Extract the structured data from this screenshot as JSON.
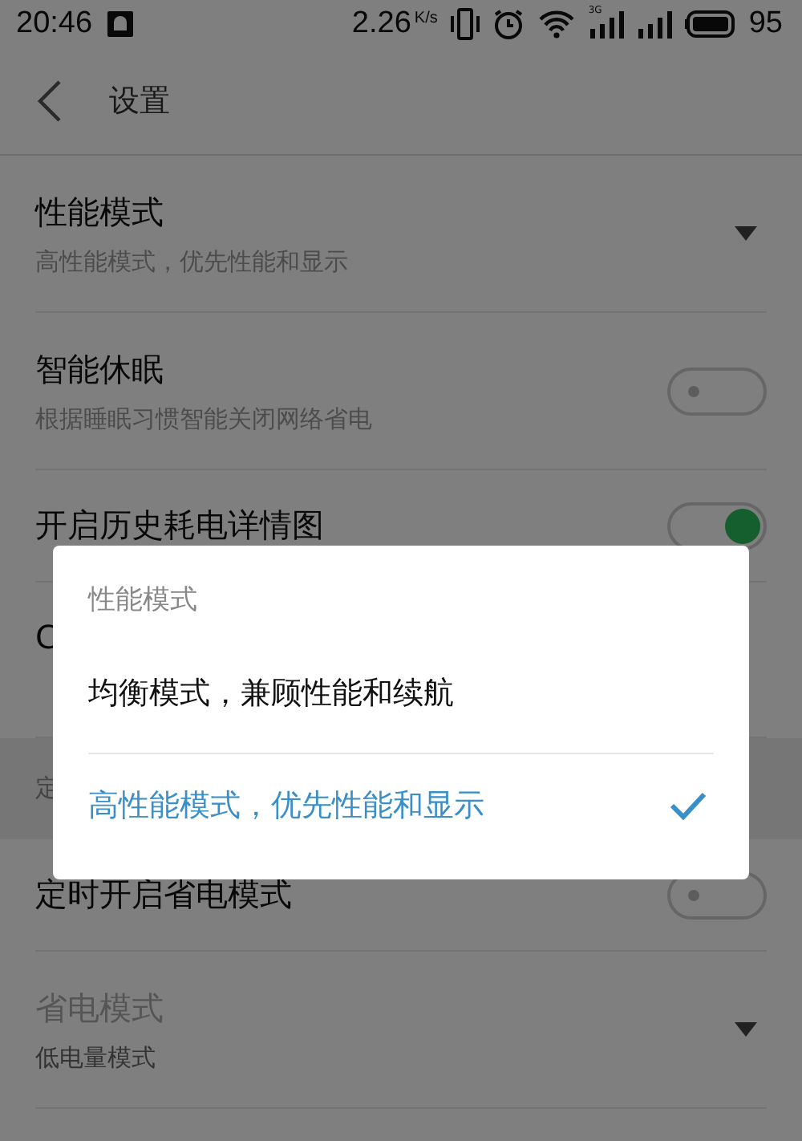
{
  "status_bar": {
    "time": "20:46",
    "speed": "2.26",
    "speed_unit": "K/s",
    "network": "3G",
    "battery": "95"
  },
  "header": {
    "title": "设置"
  },
  "rows": [
    {
      "kind": "dropdown",
      "title": "性能模式",
      "subtitle": "高性能模式，优先性能和显示",
      "disabled": false
    },
    {
      "kind": "toggle",
      "title": "智能休眠",
      "subtitle": "根据睡眠习惯智能关闭网络省电",
      "on": false
    },
    {
      "kind": "toggle",
      "title": "开启历史耗电详情图",
      "on": true
    },
    {
      "kind": "covered",
      "title": "C"
    },
    {
      "kind": "header",
      "title": "定"
    },
    {
      "kind": "toggle",
      "title": "定时开启省电模式",
      "on": false
    },
    {
      "kind": "dropdown",
      "title": "省电模式",
      "subtitle": "低电量模式",
      "disabled": true
    }
  ],
  "dialog": {
    "title": "性能模式",
    "options": [
      {
        "label": "均衡模式，兼顾性能和续航",
        "selected": false
      },
      {
        "label": "高性能模式，优先性能和显示",
        "selected": true
      }
    ]
  }
}
